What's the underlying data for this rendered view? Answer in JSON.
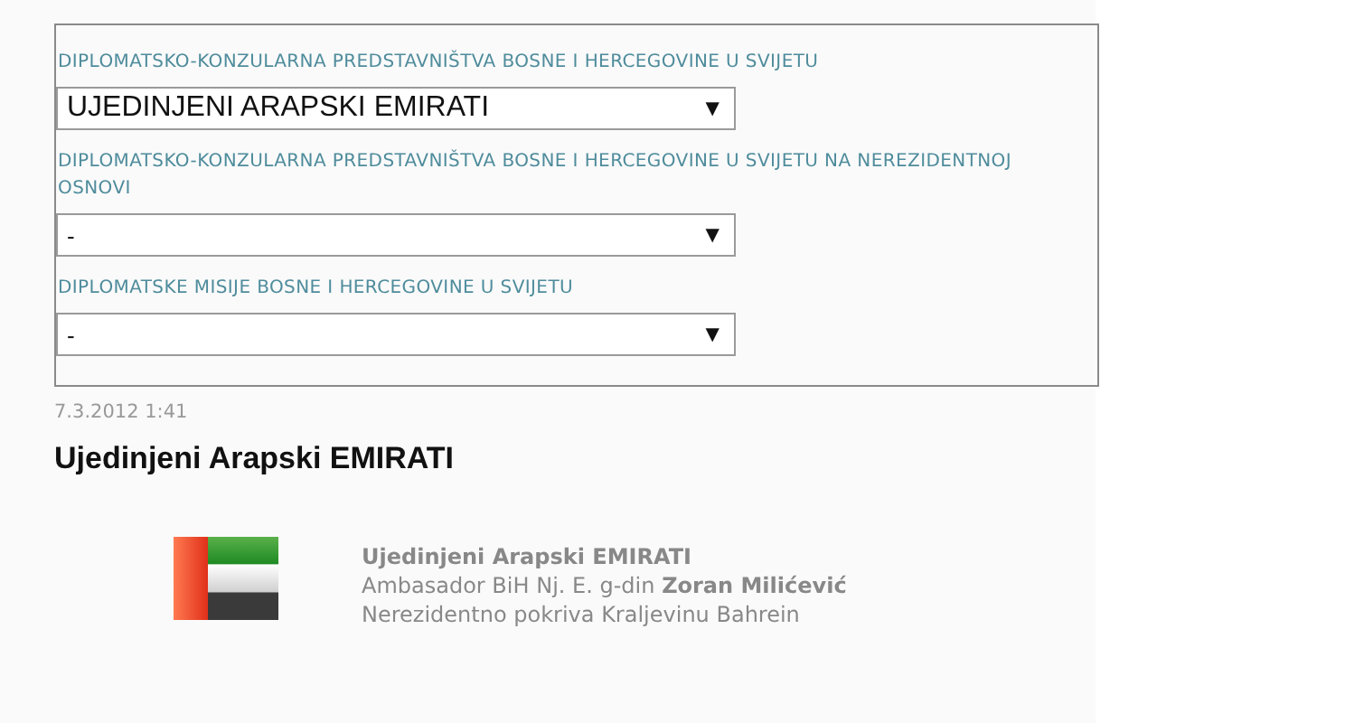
{
  "selectors": [
    {
      "label": "DIPLOMATSKO-KONZULARNA PREDSTAVNIŠTVA BOSNE I HERCEGOVINE U SVIJETU",
      "value": "UJEDINJENI ARAPSKI EMIRATI",
      "caret": "▼"
    },
    {
      "label": "DIPLOMATSKO-KONZULARNA PREDSTAVNIŠTVA BOSNE I HERCEGOVINE U SVIJETU NA NEREZIDENTNOJ OSNOVI",
      "value": "-",
      "caret": "▼"
    },
    {
      "label": "DIPLOMATSKE MISIJE BOSNE I HERCEGOVINE U SVIJETU",
      "value": "-",
      "caret": "▼"
    }
  ],
  "article": {
    "date": "7.3.2012 1:41",
    "title": "Ujedinjeni Arapski EMIRATI",
    "mission": {
      "name": "Ujedinjeni Arapski EMIRATI",
      "ambassador": "Ambasador BiH Nj. E. g-din **Zoran Milićević**",
      "coverage": "Nerezidentno pokriva Kraljevinu Bahrein"
    }
  }
}
